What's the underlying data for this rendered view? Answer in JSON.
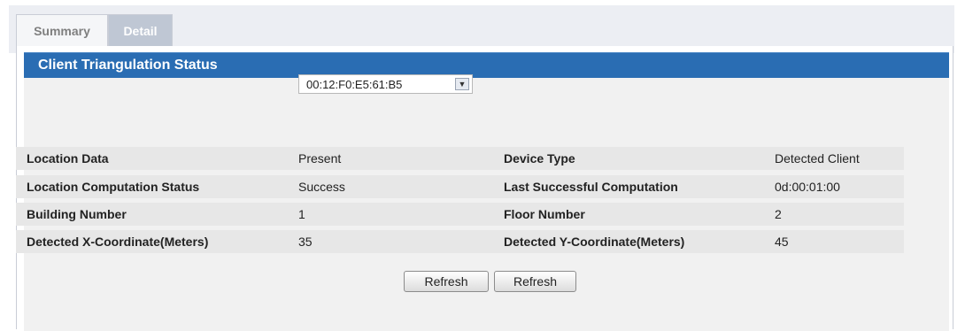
{
  "tabs": [
    {
      "label": "Summary",
      "active": false
    },
    {
      "label": "Detail",
      "active": true
    }
  ],
  "panel": {
    "title": "Client Triangulation Status"
  },
  "client_select": {
    "value": "00:12:F0:E5:61:B5"
  },
  "rows": [
    {
      "label1": "Location Data",
      "value1": "Present",
      "label2": "Device Type",
      "value2": "Detected Client"
    },
    {
      "label1": "Location Computation Status",
      "value1": "Success",
      "label2": "Last Successful Computation",
      "value2": "0d:00:01:00"
    },
    {
      "label1": "Building Number",
      "value1": "1",
      "label2": "Floor Number",
      "value2": "2"
    },
    {
      "label1": "Detected X-Coordinate(Meters)",
      "value1": "35",
      "label2": "Detected Y-Coordinate(Meters)",
      "value2": "45"
    }
  ],
  "buttons": {
    "refresh_1": "Refresh",
    "refresh_2": "Refresh"
  },
  "colors": {
    "header_bg": "#2a6db3",
    "row_bg": "#e7e7e7",
    "tab_active_bg": "#bfc7d4"
  }
}
